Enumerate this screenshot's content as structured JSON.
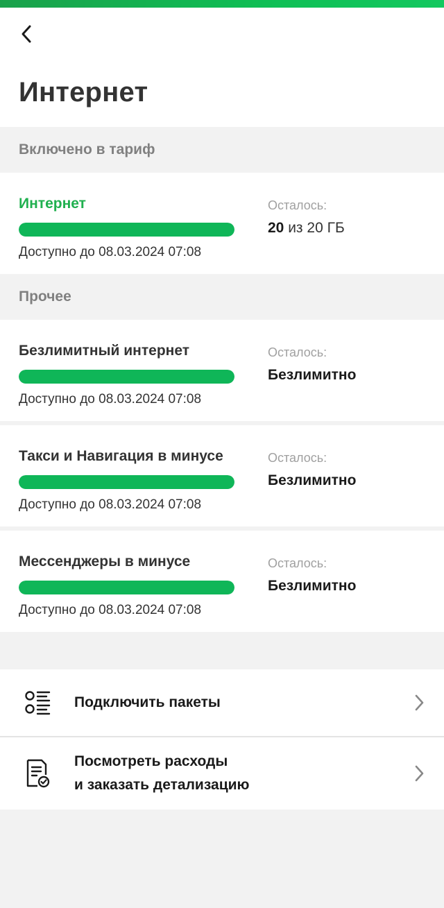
{
  "header": {
    "title": "Интернет",
    "back_icon": "chevron-left-icon"
  },
  "tariff": {
    "section_title": "Включено в тариф",
    "item": {
      "name": "Интернет",
      "available_until": "Доступно до 08.03.2024 07:08",
      "remaining_label": "Осталось:",
      "remaining_amount": "20",
      "remaining_rest": " из 20 ГБ",
      "fill_fraction": 1.0
    }
  },
  "other": {
    "section_title": "Прочее",
    "items": [
      {
        "name": "Безлимитный интернет",
        "available_until": "Доступно до 08.03.2024 07:08",
        "remaining_label": "Осталось:",
        "remaining_value": "Безлимитно",
        "fill_fraction": 1.0
      },
      {
        "name": "Такси и Навигация в минусе",
        "available_until": "Доступно до 08.03.2024 07:08",
        "remaining_label": "Осталось:",
        "remaining_value": "Безлимитно",
        "fill_fraction": 1.0
      },
      {
        "name": "Мессенджеры в минусе",
        "available_until": "Доступно до 08.03.2024 07:08",
        "remaining_label": "Осталось:",
        "remaining_value": "Безлимитно",
        "fill_fraction": 1.0
      }
    ]
  },
  "actions": [
    {
      "label": "Подключить пакеты",
      "icon": "packages-list-icon"
    },
    {
      "label_line1": "Посмотреть расходы",
      "label_line2": "и заказать детализацию",
      "icon": "document-check-icon"
    }
  ],
  "colors": {
    "accent": "#20b04f",
    "bar": "#0fb658",
    "header_strip": "#13c85f"
  }
}
